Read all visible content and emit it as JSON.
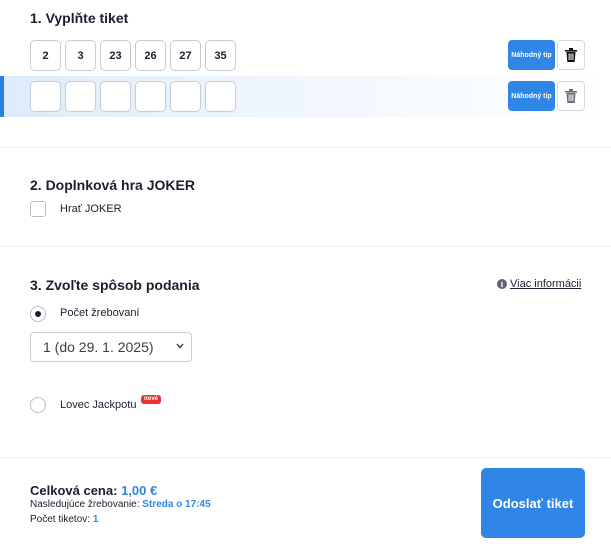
{
  "section1": {
    "title": "1. Vyplňte tiket",
    "rows": [
      {
        "numbers": [
          "2",
          "3",
          "23",
          "26",
          "27",
          "35"
        ],
        "random_label": "Náhodný tip"
      },
      {
        "numbers": [
          "",
          "",
          "",
          "",
          "",
          ""
        ],
        "random_label": "Náhodný tip"
      }
    ]
  },
  "section2": {
    "title": "2. Doplnková hra JOKER",
    "joker_label": "Hrať JOKER",
    "joker_checked": false
  },
  "section3": {
    "title": "3. Zvoľte spôsob podania",
    "info_link": "Viac informácii",
    "draw_count_label": "Počet žrebovaní",
    "draw_count_selected": true,
    "draw_select_value": "1 (do 29. 1. 2025)",
    "jackpot_label": "Lovec Jackpotu",
    "jackpot_badge": "nové",
    "jackpot_selected": false
  },
  "footer": {
    "total_label": "Celková cena:",
    "total_value": "1,00 €",
    "next_draw_label": "Nasledujúce žrebovanie:",
    "next_draw_value": "Streda o 17:45",
    "ticket_count_label": "Počet tiketov:",
    "ticket_count_value": "1",
    "submit_label": "Odoslať tiket"
  },
  "colors": {
    "accent": "#2f86e6",
    "badge": "#e8332c",
    "text": "#1d1d2f"
  }
}
